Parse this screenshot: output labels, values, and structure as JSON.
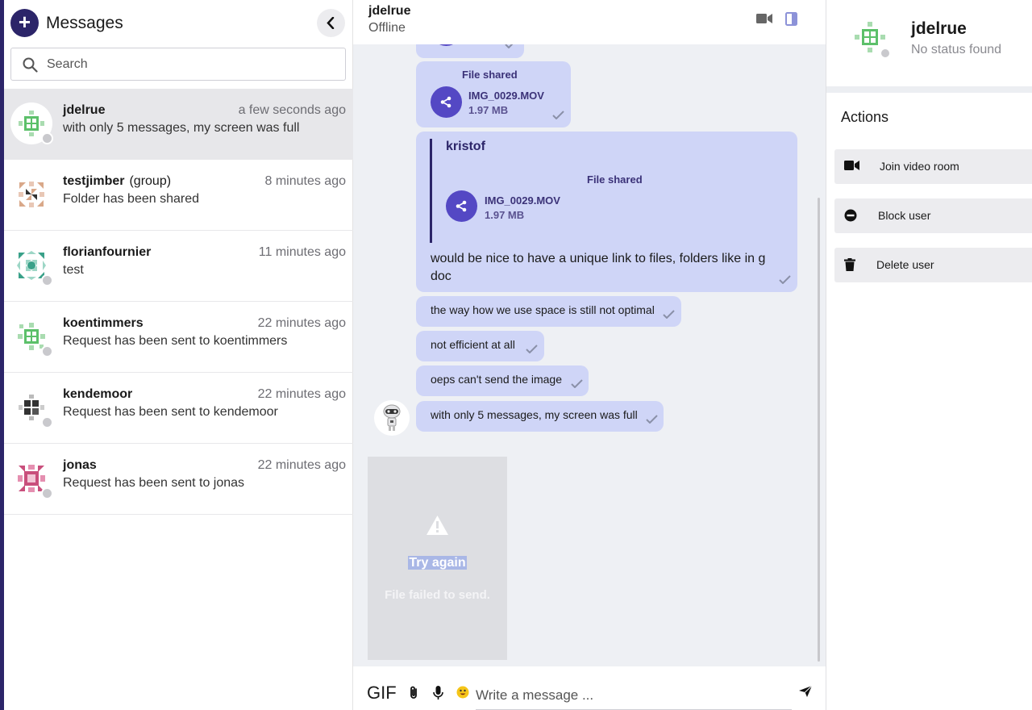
{
  "sidebar": {
    "title": "Messages",
    "search_placeholder": "Search",
    "conversations": [
      {
        "name": "jdelrue",
        "tag": "",
        "time": "a few seconds ago",
        "preview": "with only 5 messages, my screen was full"
      },
      {
        "name": "testjimber",
        "tag": "(group)",
        "time": "8 minutes ago",
        "preview": "Folder has been shared"
      },
      {
        "name": "florianfournier",
        "tag": "",
        "time": "11 minutes ago",
        "preview": "test"
      },
      {
        "name": "koentimmers",
        "tag": "",
        "time": "22 minutes ago",
        "preview": "Request has been sent to koentimmers"
      },
      {
        "name": "kendemoor",
        "tag": "",
        "time": "22 minutes ago",
        "preview": "Request has been sent to kendemoor"
      },
      {
        "name": "jonas",
        "tag": "",
        "time": "22 minutes ago",
        "preview": "Request has been sent to jonas"
      }
    ]
  },
  "chat": {
    "name": "jdelrue",
    "status": "Offline",
    "file1": {
      "label": "File shared",
      "filename": "IMG_0029.MOV",
      "size": "1.97 MB"
    },
    "quoted": {
      "author": "kristof",
      "label": "File shared",
      "filename": "IMG_0029.MOV",
      "size": "1.97 MB",
      "reply_line1": "would be nice to have a unique link to files, folders like in g",
      "reply_line2": "doc"
    },
    "messages": [
      "the way how we use space is still not optimal",
      "not efficient at all",
      "oeps can't send the image",
      "with only 5 messages, my screen was full"
    ],
    "failed": {
      "try_again": "Try again",
      "text": "File failed to send."
    },
    "composer": {
      "gif_label": "GIF",
      "placeholder": "Write a message ..."
    }
  },
  "profile": {
    "name": "jdelrue",
    "status": "No status found",
    "actions_title": "Actions",
    "actions": [
      {
        "label": "Join video room",
        "icon": "video-camera-icon"
      },
      {
        "label": "Block user",
        "icon": "block-icon"
      },
      {
        "label": "Delete user",
        "icon": "trash-icon"
      }
    ]
  },
  "colors": {
    "accent": "#2c2569",
    "bubble": "#cfd5f7",
    "share": "#5448c4"
  }
}
